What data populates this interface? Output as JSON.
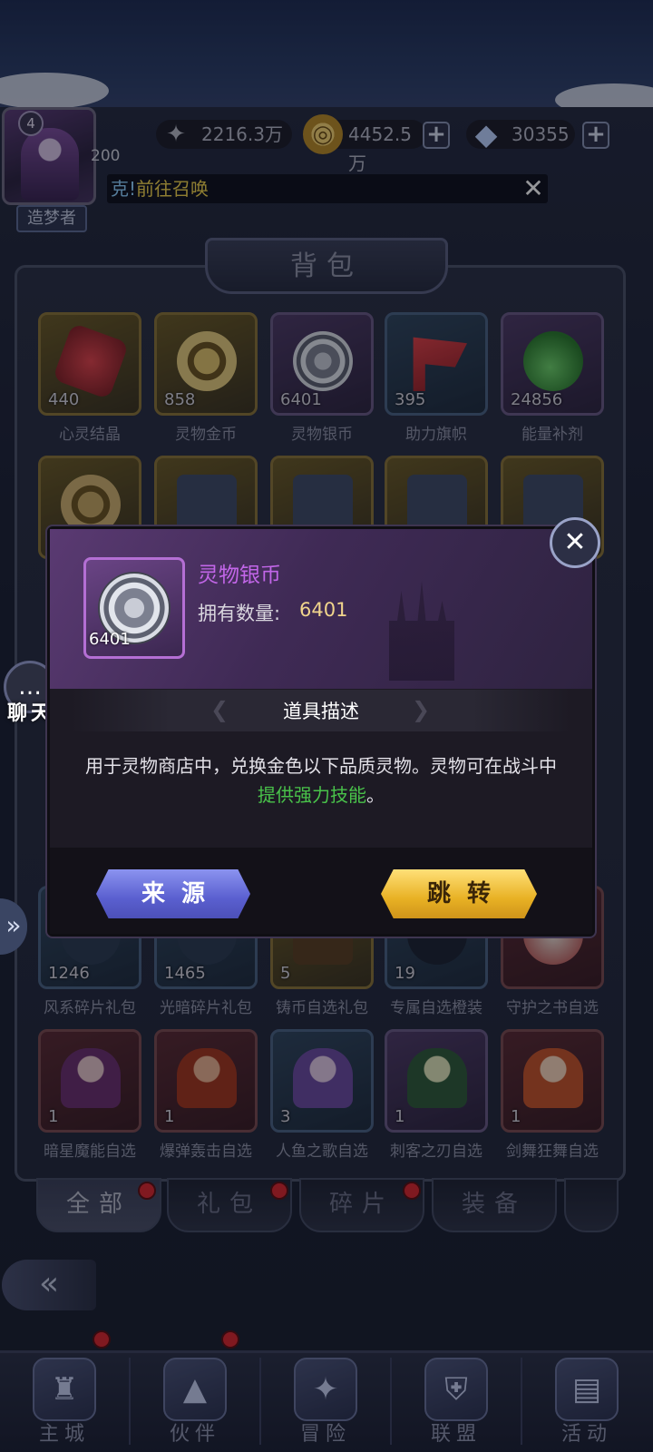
{
  "player": {
    "level": "4",
    "number": "200",
    "title": "造梦者"
  },
  "resources": [
    {
      "icon": "wings-icon",
      "value": "2216.3万",
      "has_plus": false
    },
    {
      "icon": "gold-coin-icon",
      "value": "4452.5万",
      "has_plus": true
    },
    {
      "icon": "diamond-icon",
      "value": "30355",
      "has_plus": true
    }
  ],
  "marquee": {
    "prefix": "克!",
    "link": "前往召唤"
  },
  "bag": {
    "title": "背包",
    "rows": [
      [
        {
          "count": "440",
          "name": "心灵结晶",
          "quality": "red"
        },
        {
          "count": "858",
          "name": "灵物金币",
          "quality": "gold"
        },
        {
          "count": "6401",
          "name": "灵物银币",
          "quality": "purple"
        },
        {
          "count": "395",
          "name": "助力旗帜",
          "quality": "blue"
        },
        {
          "count": "24856",
          "name": "能量补剂",
          "quality": "purple"
        }
      ],
      [
        {
          "count": "1246",
          "name": "风系碎片礼包",
          "quality": "blue"
        },
        {
          "count": "1465",
          "name": "光暗碎片礼包",
          "quality": "blue"
        },
        {
          "count": "5",
          "name": "铸币自选礼包",
          "quality": "gold"
        },
        {
          "count": "19",
          "name": "专属自选橙装",
          "quality": "blue"
        },
        {
          "count": "",
          "name": "守护之书自选",
          "quality": "red"
        }
      ],
      [
        {
          "count": "1",
          "name": "暗星魔能自选",
          "quality": "red"
        },
        {
          "count": "1",
          "name": "爆弹轰击自选",
          "quality": "red"
        },
        {
          "count": "3",
          "name": "人鱼之歌自选",
          "quality": "blue"
        },
        {
          "count": "1",
          "name": "刺客之刃自选",
          "quality": "purple"
        },
        {
          "count": "1",
          "name": "剑舞狂舞自选",
          "quality": "red"
        }
      ]
    ],
    "tabs": [
      "全部",
      "礼包",
      "碎片",
      "装备"
    ]
  },
  "side": {
    "chat_label": "聊天",
    "chat_icon": "speech-bubble-icon"
  },
  "popup": {
    "item_name": "灵物银币",
    "count": "6401",
    "own_label": "拥有数量:",
    "own_value": "6401",
    "desc_title": "道具描述",
    "desc_part1": "用于灵物商店中，兑换金色以下品质灵物。灵物可在战斗中",
    "desc_highlight": "提供强力技能",
    "desc_part2": "。",
    "btn_source": "来源",
    "btn_jump": "跳转",
    "colors": {
      "name": "#c266e8",
      "highlight": "#49c24a",
      "value": "#f1d58c"
    }
  },
  "bottom_nav": [
    {
      "label": "主城",
      "icon": "castle-icon",
      "badge": true
    },
    {
      "label": "伙伴",
      "icon": "witch-hat-icon",
      "badge": true
    },
    {
      "label": "冒险",
      "icon": "compass-icon",
      "badge": false
    },
    {
      "label": "联盟",
      "icon": "shield-icon",
      "badge": false
    },
    {
      "label": "活动",
      "icon": "cards-icon",
      "badge": false
    }
  ]
}
